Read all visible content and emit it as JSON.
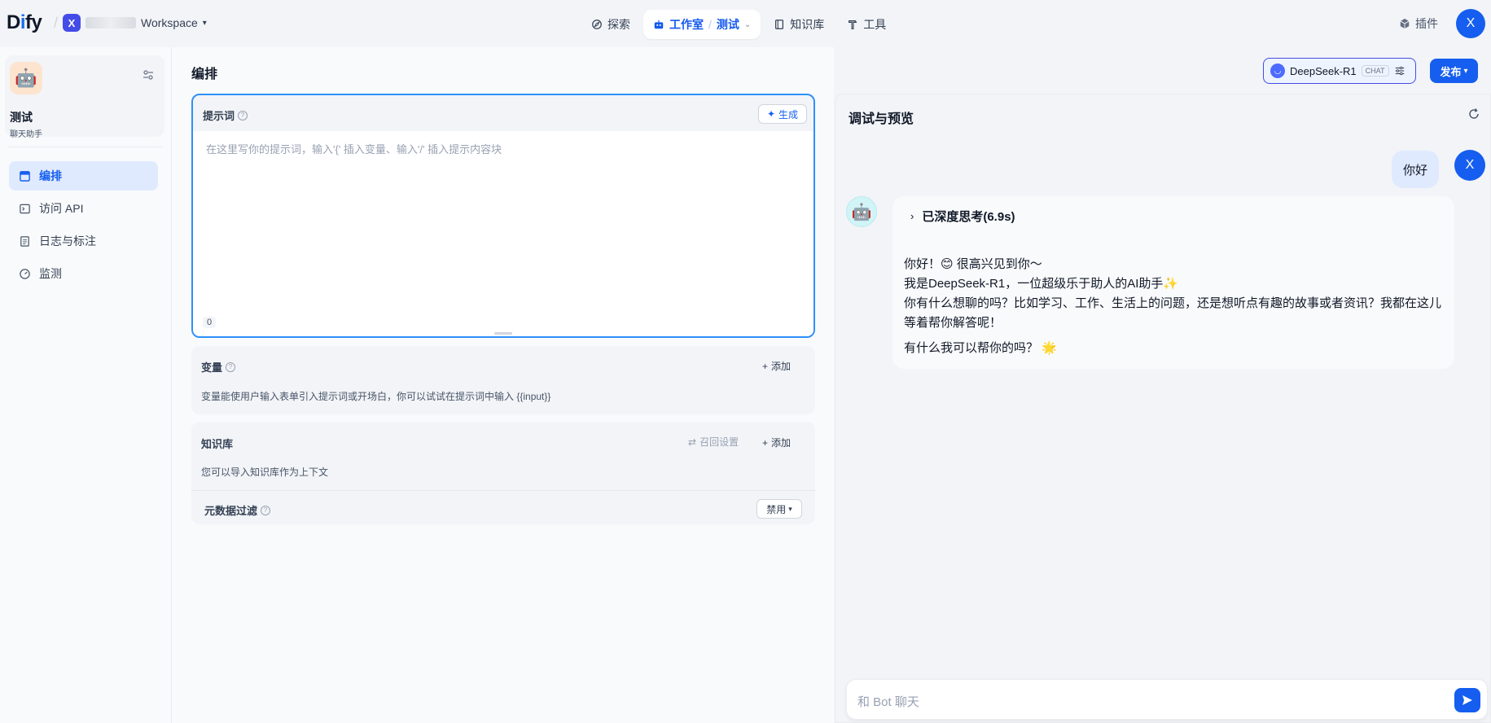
{
  "brand": {
    "logo_text_1": "D",
    "logo_text_2": "i",
    "logo_text_3": "fy"
  },
  "workspace": {
    "badge": "X",
    "name": "Workspace"
  },
  "nav": {
    "explore": "探索",
    "studio": "工作室",
    "app": "测试",
    "knowledge": "知识库",
    "tools": "工具"
  },
  "header_right": {
    "plugins": "插件",
    "avatar": "X"
  },
  "app": {
    "title": "测试",
    "subtitle": "聊天助手"
  },
  "sidebar": {
    "items": [
      {
        "label": "编排",
        "icon": "layout-icon"
      },
      {
        "label": "访问 API",
        "icon": "terminal-icon"
      },
      {
        "label": "日志与标注",
        "icon": "file-list-icon"
      },
      {
        "label": "监测",
        "icon": "dashboard-icon"
      }
    ]
  },
  "main": {
    "title": "编排",
    "model": {
      "name": "DeepSeek-R1",
      "tag": "CHAT"
    },
    "publish": "发布"
  },
  "prompt": {
    "label": "提示词",
    "generate": "生成",
    "placeholder": "在这里写你的提示词，输入'{' 插入变量、输入'/' 插入提示内容块",
    "count": "0"
  },
  "variables": {
    "label": "变量",
    "add": "添加",
    "desc": "变量能使用户输入表单引入提示词或开场白，你可以试试在提示词中输入 {{input}}"
  },
  "knowledge": {
    "label": "知识库",
    "recall": "召回设置",
    "add": "添加",
    "desc": "您可以导入知识库作为上下文",
    "metadata_label": "元数据过滤",
    "metadata_value": "禁用"
  },
  "debug": {
    "title": "调试与预览",
    "user_message": "你好",
    "user_avatar": "X",
    "thinking": "已深度思考(6.9s)",
    "bot_lines": [
      "你好！😊 很高兴见到你～",
      "我是DeepSeek-R1，一位超级乐于助人的AI助手✨",
      "你有什么想聊的吗？比如学习、工作、生活上的问题，还是想听点有趣的故事或者资讯？我都在这儿",
      "等着帮你解答呢！",
      "有什么我可以帮你的吗？ 🌟"
    ],
    "input_placeholder": "和 Bot 聊天"
  }
}
